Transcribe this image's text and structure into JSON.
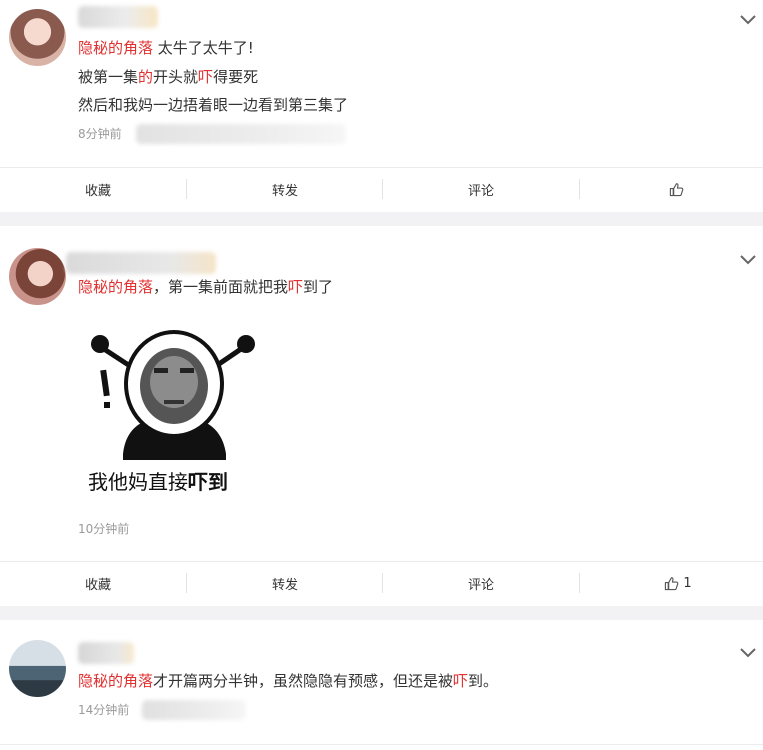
{
  "comments": [
    {
      "username": "隐秘的角落",
      "text_suffix": "太牛了太牛了!",
      "line2": {
        "a": "被第一集",
        "hl1": "的",
        "b": "开头就",
        "hl2": "吓",
        "c": "得要死"
      },
      "line3": "然后和我妈一边捂着眼一边看到第三集了",
      "time": "8分钟前"
    },
    {
      "username": "隐秘的角落",
      "text_a": "，第一集前面就把我",
      "text_hl": "吓",
      "text_b": "到了",
      "meme_caption_a": "我他妈直接",
      "meme_caption_b": "吓到",
      "meme_exclaim": "!",
      "time": "10分钟前"
    },
    {
      "username": "隐秘的角落",
      "text_a": "才开篇两分半钟，虽然隐隐有预感，但还是被",
      "text_hl": "吓",
      "text_b": "到。",
      "time": "14分钟前"
    }
  ],
  "actions": [
    {
      "collect": "收藏",
      "repost": "转发",
      "comment": "评论",
      "like_count": ""
    },
    {
      "collect": "收藏",
      "repost": "转发",
      "comment": "评论",
      "like_count": "1"
    }
  ],
  "icons": {
    "like": "thumbs-up-icon",
    "expand": "chevron-down-icon"
  },
  "colors": {
    "highlight": "#e0302f",
    "meta": "#9a9a9a",
    "background": "#f2f2f5"
  }
}
